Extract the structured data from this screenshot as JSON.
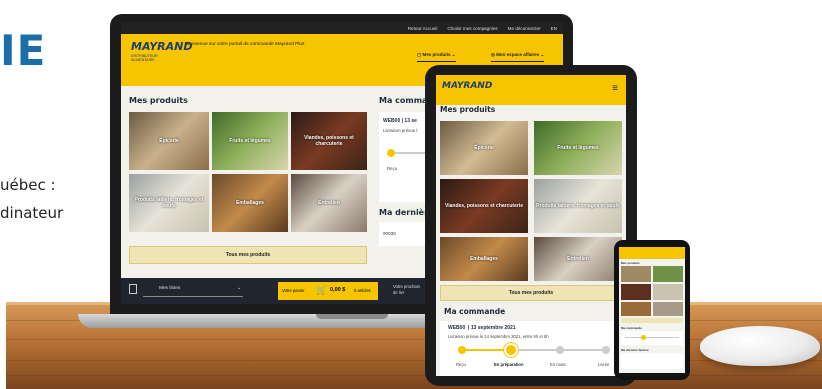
{
  "left_text": {
    "heading": "IE",
    "line1": "uébec :",
    "line2": "dinateur"
  },
  "laptop": {
    "top_nav": [
      "Retour Accueil",
      "Choisir mes compagnies",
      "Me déconnecter",
      "EN"
    ],
    "logo": "MAYRAND",
    "logo_sub": "DISTRIBUTEUR ALIMENTAIRE",
    "welcome": "Bienvenue sur votre portail de commande Mayrand Plus",
    "menu_products": "Mes produits",
    "menu_space": "Mon espace affaires",
    "products_title": "Mes produits",
    "tiles": [
      "Épicerie",
      "Fruits et légumes",
      "Viandes, poissons et charcuterie",
      "Produits laitiers, fromages et oeufs",
      "Emballages",
      "Entretien"
    ],
    "all_products": "Tous mes produits",
    "order_title": "Ma commande",
    "order_id": "WEB00",
    "order_date_partial": "| 13 se",
    "order_delivery_partial": "Livraison prévue l",
    "order_step_recu": "Reçu",
    "invoice_title": "Ma dernière fa",
    "invoice_no": "#0030",
    "lists_select": "Mes listes",
    "cart_label": "Votre panier",
    "cart_total": "0,00 $",
    "cart_items": "0 articles",
    "next_label": "Votre prochain",
    "next_label_2": "de livr"
  },
  "tablet": {
    "logo": "MAYRAND",
    "products_title": "Mes produits",
    "tiles": [
      "Épicerie",
      "Fruits et légumes",
      "Viandes, poissons et charcuterie",
      "Produits laitiers, fromages et oeufs",
      "Emballages",
      "Entretien"
    ],
    "all_products": "Tous mes produits",
    "order_title": "Ma commande",
    "order_id": "WEB00",
    "order_date": "13 septembre 2021",
    "delivery": "Livraison prévue le 14 septembre 2021, entre 9h et 5h",
    "steps": [
      "Reçu",
      "En préparation",
      "En route",
      "Livrée"
    ],
    "progress": 0.33
  },
  "phone": {
    "products_title": "Mes produits",
    "order_title": "Ma commande",
    "invoice_title": "Ma dernière facture"
  },
  "colors": {
    "yellow": "#f6c500",
    "navy": "#1e3d6e",
    "dark": "#1f2630"
  }
}
